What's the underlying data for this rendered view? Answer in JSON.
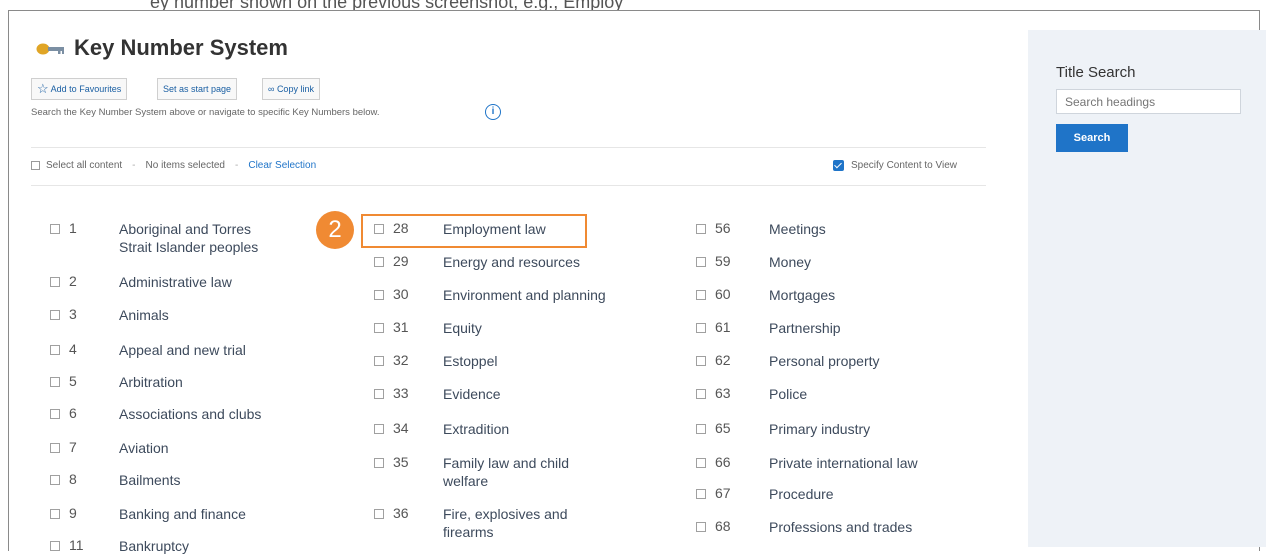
{
  "header_fragment": "ey number shown on the previous screenshot, e.g., Employ",
  "page": {
    "title": "Key Number System",
    "toolbar": {
      "favourites_label": "Add to Favourites",
      "start_page_label": "Set as start page",
      "copy_link_label": "Copy link"
    },
    "instructions": "Search the Key Number System above or navigate to specific Key Numbers below."
  },
  "selection": {
    "select_all_label": "Select all content",
    "status": "No items selected",
    "clear_label": "Clear Selection",
    "specify_label": "Specify Content to View"
  },
  "sidebar": {
    "title": "Title Search",
    "search_placeholder": "Search headings",
    "search_button": "Search"
  },
  "annotation": {
    "step": "2"
  },
  "topics": {
    "col1": [
      {
        "num": "1",
        "label": "Aboriginal and Torres Strait Islander peoples"
      },
      {
        "num": "2",
        "label": "Administrative law"
      },
      {
        "num": "3",
        "label": "Animals"
      },
      {
        "num": "4",
        "label": "Appeal and new trial"
      },
      {
        "num": "5",
        "label": "Arbitration"
      },
      {
        "num": "6",
        "label": "Associations and clubs"
      },
      {
        "num": "7",
        "label": "Aviation"
      },
      {
        "num": "8",
        "label": "Bailments"
      },
      {
        "num": "9",
        "label": "Banking and finance"
      },
      {
        "num": "11",
        "label": "Bankruptcy"
      }
    ],
    "col2": [
      {
        "num": "28",
        "label": "Employment law"
      },
      {
        "num": "29",
        "label": "Energy and resources"
      },
      {
        "num": "30",
        "label": "Environment and planning"
      },
      {
        "num": "31",
        "label": "Equity"
      },
      {
        "num": "32",
        "label": "Estoppel"
      },
      {
        "num": "33",
        "label": "Evidence"
      },
      {
        "num": "34",
        "label": "Extradition"
      },
      {
        "num": "35",
        "label": "Family law and child welfare"
      },
      {
        "num": "36",
        "label": "Fire, explosives and firearms"
      }
    ],
    "col3": [
      {
        "num": "56",
        "label": "Meetings"
      },
      {
        "num": "59",
        "label": "Money"
      },
      {
        "num": "60",
        "label": "Mortgages"
      },
      {
        "num": "61",
        "label": "Partnership"
      },
      {
        "num": "62",
        "label": "Personal property"
      },
      {
        "num": "63",
        "label": "Police"
      },
      {
        "num": "65",
        "label": "Primary industry"
      },
      {
        "num": "66",
        "label": "Private international law"
      },
      {
        "num": "67",
        "label": "Procedure"
      },
      {
        "num": "68",
        "label": "Professions and trades"
      }
    ]
  },
  "colors": {
    "accent": "#1f74c8",
    "highlight": "#f08a33",
    "panel": "#eef2f7"
  }
}
